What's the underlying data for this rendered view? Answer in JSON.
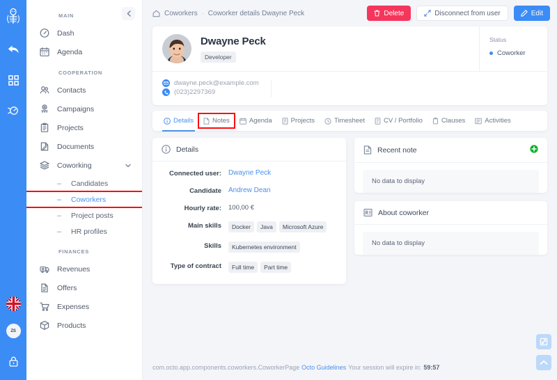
{
  "rail": {
    "logo_icon": "octo-logo-icon",
    "icons": [
      "back-arrow-icon",
      "grid-apps-icon",
      "speedometer-icon"
    ],
    "flag": "uk-flag-icon",
    "avatar_initials": "ZS",
    "lock_icon": "lock-icon"
  },
  "sidebar": {
    "collapse_label": "‹",
    "sections": [
      {
        "title": "MAIN",
        "items": [
          {
            "label": "Dash",
            "icon": "dashboard-icon"
          },
          {
            "label": "Agenda",
            "icon": "calendar-icon"
          }
        ]
      },
      {
        "title": "COOPERATION",
        "items": [
          {
            "label": "Contacts",
            "icon": "contacts-icon"
          },
          {
            "label": "Campaigns",
            "icon": "campaign-icon"
          },
          {
            "label": "Projects",
            "icon": "clipboard-icon"
          },
          {
            "label": "Documents",
            "icon": "documents-icon"
          },
          {
            "label": "Coworking",
            "icon": "layers-icon",
            "expanded": true
          }
        ],
        "subitems": [
          {
            "label": "Candidates",
            "active": false,
            "highlighted": false
          },
          {
            "label": "Coworkers",
            "active": true,
            "highlighted": true
          },
          {
            "label": "Project posts",
            "active": false,
            "highlighted": false
          },
          {
            "label": "HR profiles",
            "active": false,
            "highlighted": false
          }
        ]
      },
      {
        "title": "FINANCES",
        "items": [
          {
            "label": "Revenues",
            "icon": "revenues-icon"
          },
          {
            "label": "Offers",
            "icon": "offer-document-icon"
          },
          {
            "label": "Expenses",
            "icon": "shopping-cart-icon"
          },
          {
            "label": "Products",
            "icon": "box-icon"
          }
        ]
      }
    ]
  },
  "topbar": {
    "breadcrumb_root": "Coworkers",
    "breadcrumb_separator": "·",
    "breadcrumb_current": "Coworker details Dwayne Peck",
    "buttons": {
      "delete": "Delete",
      "disconnect": "Disconnect from user",
      "edit": "Edit"
    }
  },
  "profile": {
    "name": "Dwayne Peck",
    "role_tag": "Developer",
    "email": "dwayne.peck@example.com",
    "phone": "(023)2297369",
    "status_label": "Status",
    "status_value": "Coworker"
  },
  "tabs": [
    {
      "label": "Details",
      "icon": "info-circle-icon",
      "active": true,
      "highlighted": false
    },
    {
      "label": "Notes",
      "icon": "note-icon",
      "active": false,
      "highlighted": true
    },
    {
      "label": "Agenda",
      "icon": "calendar-icon",
      "active": false,
      "highlighted": false
    },
    {
      "label": "Projects",
      "icon": "projects-icon",
      "active": false,
      "highlighted": false
    },
    {
      "label": "Timesheet",
      "icon": "clock-icon",
      "active": false,
      "highlighted": false
    },
    {
      "label": "CV / Portfolio",
      "icon": "cv-icon",
      "active": false,
      "highlighted": false
    },
    {
      "label": "Clauses",
      "icon": "clause-icon",
      "active": false,
      "highlighted": false
    },
    {
      "label": "Activities",
      "icon": "activities-icon",
      "active": false,
      "highlighted": false
    }
  ],
  "details_card": {
    "title": "Details",
    "icon": "info-circle-icon",
    "rows": [
      {
        "label": "Connected user:",
        "type": "link",
        "value": "Dwayne Peck"
      },
      {
        "label": "Candidate",
        "type": "link",
        "value": "Andrew Dean"
      },
      {
        "label": "Hourly rate:",
        "type": "text",
        "value": "100,00 €"
      },
      {
        "label": "Main skills",
        "type": "chips",
        "chips": [
          "Docker",
          "Java",
          "Microsoft Azure"
        ]
      },
      {
        "label": "Skills",
        "type": "chips",
        "chips": [
          "Kubernetes environment"
        ]
      },
      {
        "label": "Type of contract",
        "type": "chips",
        "chips": [
          "Full time",
          "Part time"
        ]
      }
    ]
  },
  "recent_note_card": {
    "title": "Recent note",
    "icon": "note-icon",
    "add_icon": "add-circle-icon",
    "empty_text": "No data to display"
  },
  "about_card": {
    "title": "About coworker",
    "icon": "id-card-icon",
    "empty_text": "No data to display"
  },
  "footer": {
    "component_path": "com.octo.app.components.coworkers.CoworkerPage",
    "link": "Octo Guidelines",
    "session_text": "Your session will expire in:",
    "session_time": "59:57"
  },
  "fabs": [
    {
      "icon": "resize-icon"
    },
    {
      "icon": "scroll-top-icon"
    }
  ],
  "colors": {
    "brand_blue": "#3b8cf5",
    "link_blue": "#4a90e8",
    "danger_red": "#f5365c",
    "highlight_red": "#fb0d0d",
    "page_bg": "#f4f5f9"
  }
}
